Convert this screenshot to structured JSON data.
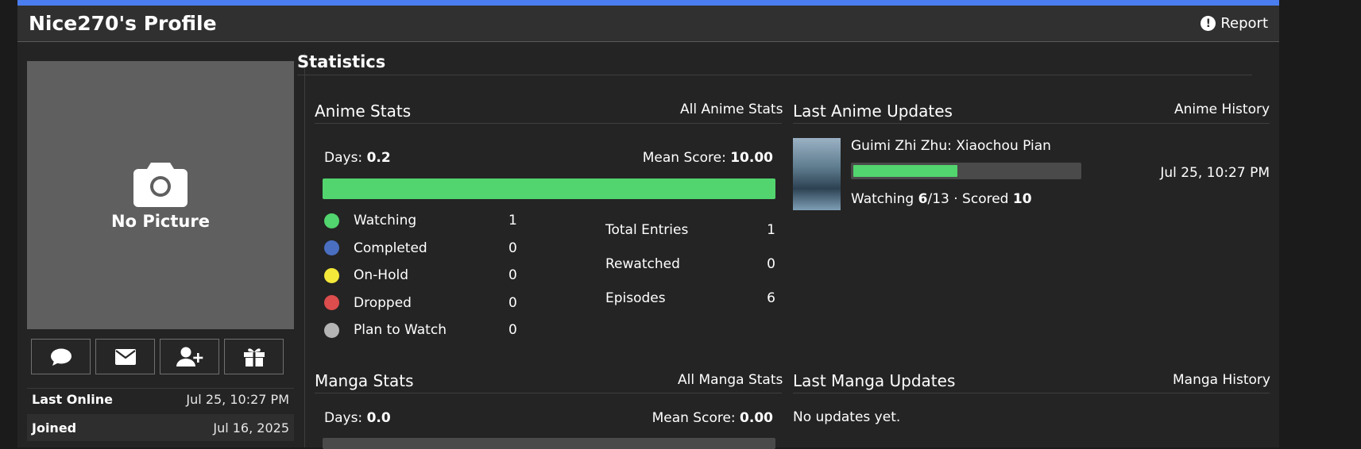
{
  "header": {
    "title": "Nice270's Profile",
    "report_label": "Report"
  },
  "profile": {
    "no_picture": "No Picture",
    "actions": [
      "comment-icon",
      "envelope-icon",
      "add-friend-icon",
      "gift-icon"
    ],
    "info": [
      {
        "label": "Last Online",
        "value": "Jul 25, 10:27 PM"
      },
      {
        "label": "Joined",
        "value": "Jul 16, 2025"
      }
    ]
  },
  "statistics": {
    "title": "Statistics",
    "anime": {
      "heading": "Anime Stats",
      "link": "All Anime Stats",
      "days_label": "Days: ",
      "days_value": "0.2",
      "mean_label": "Mean Score: ",
      "mean_value": "10.00",
      "legend": [
        {
          "label": "Watching",
          "count": "1",
          "color": "#52d46e"
        },
        {
          "label": "Completed",
          "count": "0",
          "color": "#4a6fc1"
        },
        {
          "label": "On-Hold",
          "count": "0",
          "color": "#f4e83a"
        },
        {
          "label": "Dropped",
          "count": "0",
          "color": "#dd4d4d"
        },
        {
          "label": "Plan to Watch",
          "count": "0",
          "color": "#b5b5b5"
        }
      ],
      "totals": [
        {
          "label": "Total Entries",
          "value": "1"
        },
        {
          "label": "Rewatched",
          "value": "0"
        },
        {
          "label": "Episodes",
          "value": "6"
        }
      ]
    },
    "manga": {
      "heading": "Manga Stats",
      "link": "All Manga Stats",
      "days_label": "Days: ",
      "days_value": "0.0",
      "mean_label": "Mean Score: ",
      "mean_value": "0.00"
    }
  },
  "anime_updates": {
    "heading": "Last Anime Updates",
    "link": "Anime History",
    "item": {
      "title": "Guimi Zhi Zhu: Xiaochou Pian",
      "progress": 0.46,
      "date": "Jul 25, 10:27 PM",
      "status_label": "Watching ",
      "watched": "6",
      "total": "13",
      "scored_label": " · Scored ",
      "score": "10"
    }
  },
  "manga_updates": {
    "heading": "Last Manga Updates",
    "link": "Manga History",
    "empty": "No updates yet."
  }
}
